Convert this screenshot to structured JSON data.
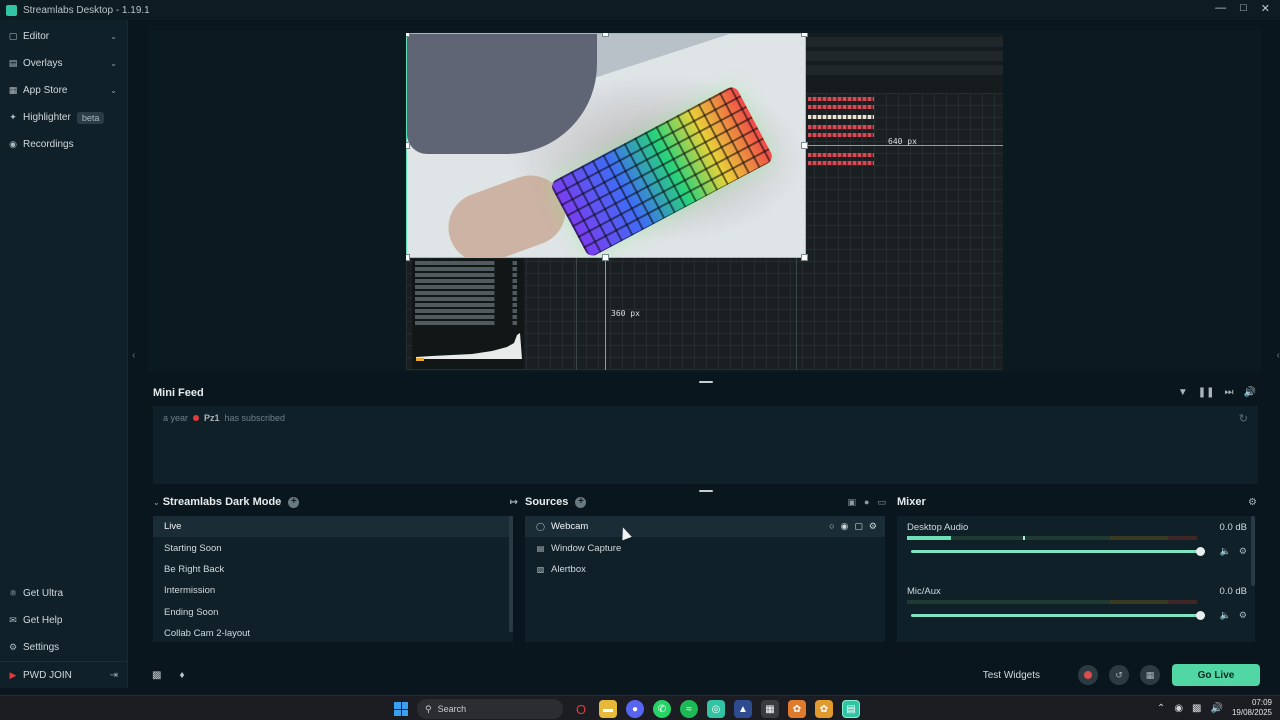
{
  "window": {
    "title": "Streamlabs Desktop - 1.19.1"
  },
  "sidebar": {
    "items": [
      {
        "label": "Editor",
        "icon": "editor-icon",
        "expandable": true
      },
      {
        "label": "Overlays",
        "icon": "overlays-icon",
        "expandable": true
      },
      {
        "label": "App Store",
        "icon": "store-icon",
        "expandable": true
      },
      {
        "label": "Highlighter",
        "icon": "highlighter-icon",
        "badge": "beta"
      },
      {
        "label": "Recordings",
        "icon": "recordings-icon"
      }
    ],
    "bottom_items": [
      {
        "label": "Get Ultra",
        "icon": "ultra-icon"
      },
      {
        "label": "Get Help",
        "icon": "help-icon"
      },
      {
        "label": "Settings",
        "icon": "gear-icon"
      }
    ],
    "account": {
      "label": "PWD JOIN"
    }
  },
  "preview": {
    "width_label": "640 px",
    "height_label": "360 px"
  },
  "mini_feed": {
    "title": "Mini Feed",
    "events": [
      {
        "time": "a year",
        "name": "Pz1",
        "text": "has subscribed"
      }
    ]
  },
  "scenes": {
    "title": "Streamlabs Dark Mode",
    "items": [
      "Live",
      "Starting Soon",
      "Be Right Back",
      "Intermission",
      "Ending Soon",
      "Collab Cam 2-layout"
    ],
    "selected": "Live"
  },
  "sources": {
    "title": "Sources",
    "items": [
      {
        "label": "Webcam",
        "icon": "webcam-icon"
      },
      {
        "label": "Window Capture",
        "icon": "window-icon"
      },
      {
        "label": "Alertbox",
        "icon": "alertbox-icon"
      }
    ]
  },
  "mixer": {
    "title": "Mixer",
    "channels": [
      {
        "label": "Desktop Audio",
        "db": "0.0 dB",
        "level": 0.15,
        "peak": 0.4,
        "volume": 1.0
      },
      {
        "label": "Mic/Aux",
        "db": "0.0 dB",
        "level": 0.0,
        "peak": 0.0,
        "volume": 1.0
      }
    ]
  },
  "bottom_bar": {
    "test_widgets": "Test Widgets",
    "go_live": "Go Live"
  },
  "taskbar": {
    "search_placeholder": "Search",
    "time": "07:09",
    "date": "19/08/2025"
  },
  "colors": {
    "accent": "#50d7a3",
    "background": "#09161d",
    "panel": "#0f2028",
    "selection_border": "#59e0b5"
  }
}
